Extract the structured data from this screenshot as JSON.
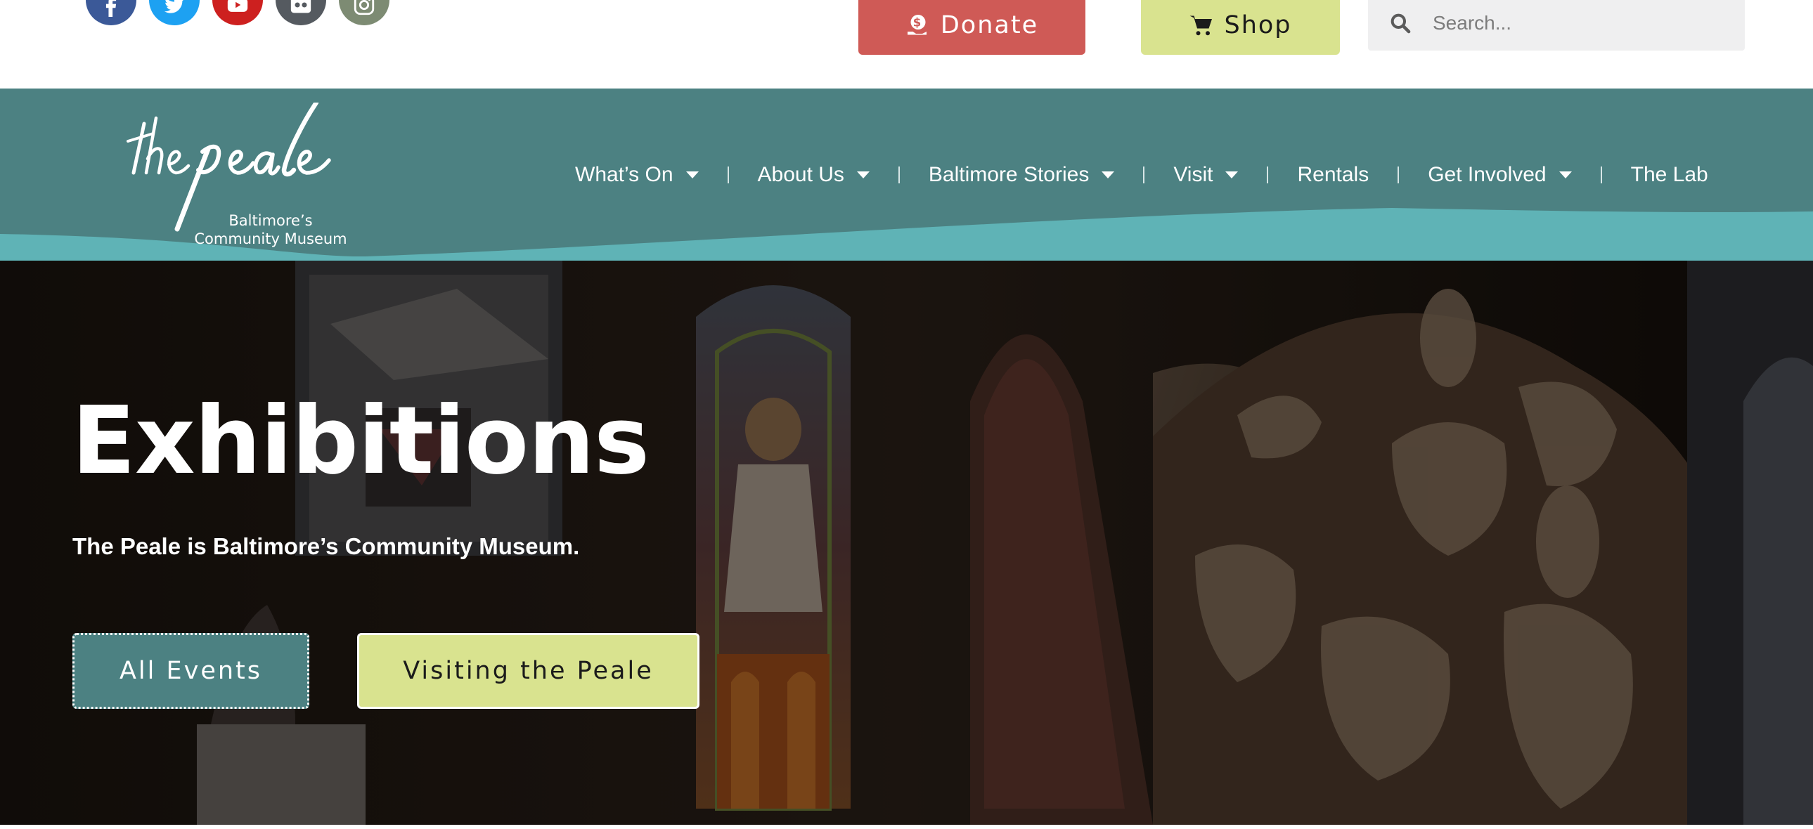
{
  "topbar": {
    "social": [
      {
        "name": "facebook-icon",
        "color": "#3b5998"
      },
      {
        "name": "twitter-icon",
        "color": "#1da1f2"
      },
      {
        "name": "youtube-icon",
        "color": "#cd201f"
      },
      {
        "name": "flickr-icon",
        "color": "#555a60"
      },
      {
        "name": "instagram-icon",
        "color": "#7d8b73"
      }
    ],
    "donate_label": "Donate",
    "shop_label": "Shop",
    "search_placeholder": "Search..."
  },
  "header": {
    "logo_wordmark": "the peale",
    "logo_line1": "Baltimore’s",
    "logo_line2": "Community Museum",
    "nav": [
      {
        "label": "What’s On",
        "has_dropdown": true
      },
      {
        "label": "About Us",
        "has_dropdown": true
      },
      {
        "label": "Baltimore Stories",
        "has_dropdown": true
      },
      {
        "label": "Visit",
        "has_dropdown": true
      },
      {
        "label": "Rentals",
        "has_dropdown": false
      },
      {
        "label": "Get Involved",
        "has_dropdown": true
      },
      {
        "label": "The Lab",
        "has_dropdown": false
      }
    ]
  },
  "hero": {
    "title": "Exhibitions",
    "subtitle": "The Peale is Baltimore’s Community Museum.",
    "button_events": "All Events",
    "button_visit": "Visiting the Peale"
  },
  "colors": {
    "header_teal": "#4c8182",
    "wave_teal": "#5fb3b6",
    "donate_red": "#cf5a56",
    "shop_lime": "#d9e38f",
    "search_bg": "#efeff0"
  }
}
